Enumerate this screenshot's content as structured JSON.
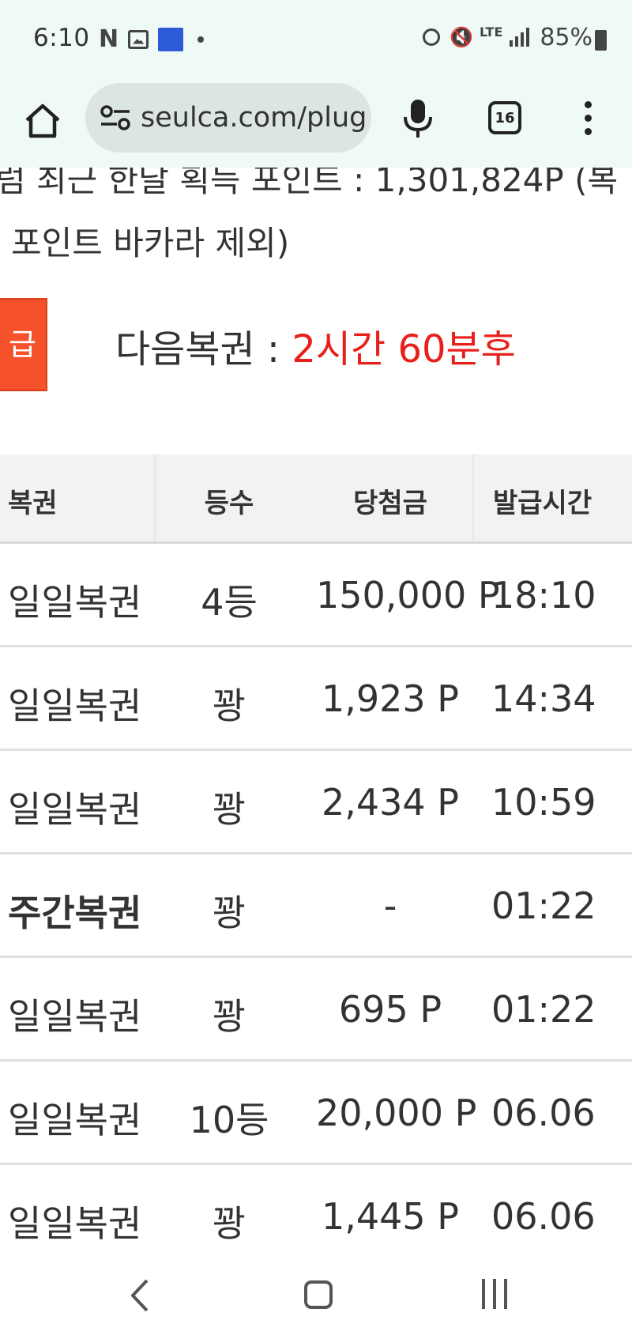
{
  "status_bar": {
    "time": "6:10",
    "n_letter": "N",
    "lte": "LTE",
    "battery": "85%"
  },
  "browser": {
    "url": "seulca.com/plug",
    "tab_count": "16"
  },
  "info": {
    "line1": "럼 최근 한달 획득 포인트 : 1,301,824P (복",
    "line2": "포인트 바카라 제외)"
  },
  "action_button_label": "급",
  "next_lottery": {
    "label": "다음복권 : ",
    "value": "2시간 60분후"
  },
  "table": {
    "headers": [
      "복권",
      "등수",
      "당첨금",
      "발급시간"
    ],
    "rows": [
      {
        "name": "일일복권",
        "rank": "4등",
        "prize": "150,000 P",
        "time": "18:10",
        "bold": false
      },
      {
        "name": "일일복권",
        "rank": "꽝",
        "prize": "1,923 P",
        "time": "14:34",
        "bold": false
      },
      {
        "name": "일일복권",
        "rank": "꽝",
        "prize": "2,434 P",
        "time": "10:59",
        "bold": false
      },
      {
        "name": "주간복권",
        "rank": "꽝",
        "prize": "-",
        "time": "01:22",
        "bold": true
      },
      {
        "name": "일일복권",
        "rank": "꽝",
        "prize": "695 P",
        "time": "01:22",
        "bold": false
      },
      {
        "name": "일일복권",
        "rank": "10등",
        "prize": "20,000 P",
        "time": "06.06",
        "bold": false
      },
      {
        "name": "일일복권",
        "rank": "꽝",
        "prize": "1,445 P",
        "time": "06.06",
        "bold": false
      }
    ]
  },
  "colors": {
    "accent_orange": "#f5512a",
    "countdown_red": "#e8201b",
    "browser_bg": "#eff9f6"
  },
  "icons": [
    "netflix-icon",
    "gallery-icon",
    "app-icon",
    "alarm-icon",
    "mute-icon",
    "signal-icon",
    "battery-icon",
    "home-icon",
    "site-settings-icon",
    "mic-icon",
    "tabs-icon",
    "more-icon",
    "back-icon",
    "home-nav-icon",
    "recent-apps-icon"
  ]
}
